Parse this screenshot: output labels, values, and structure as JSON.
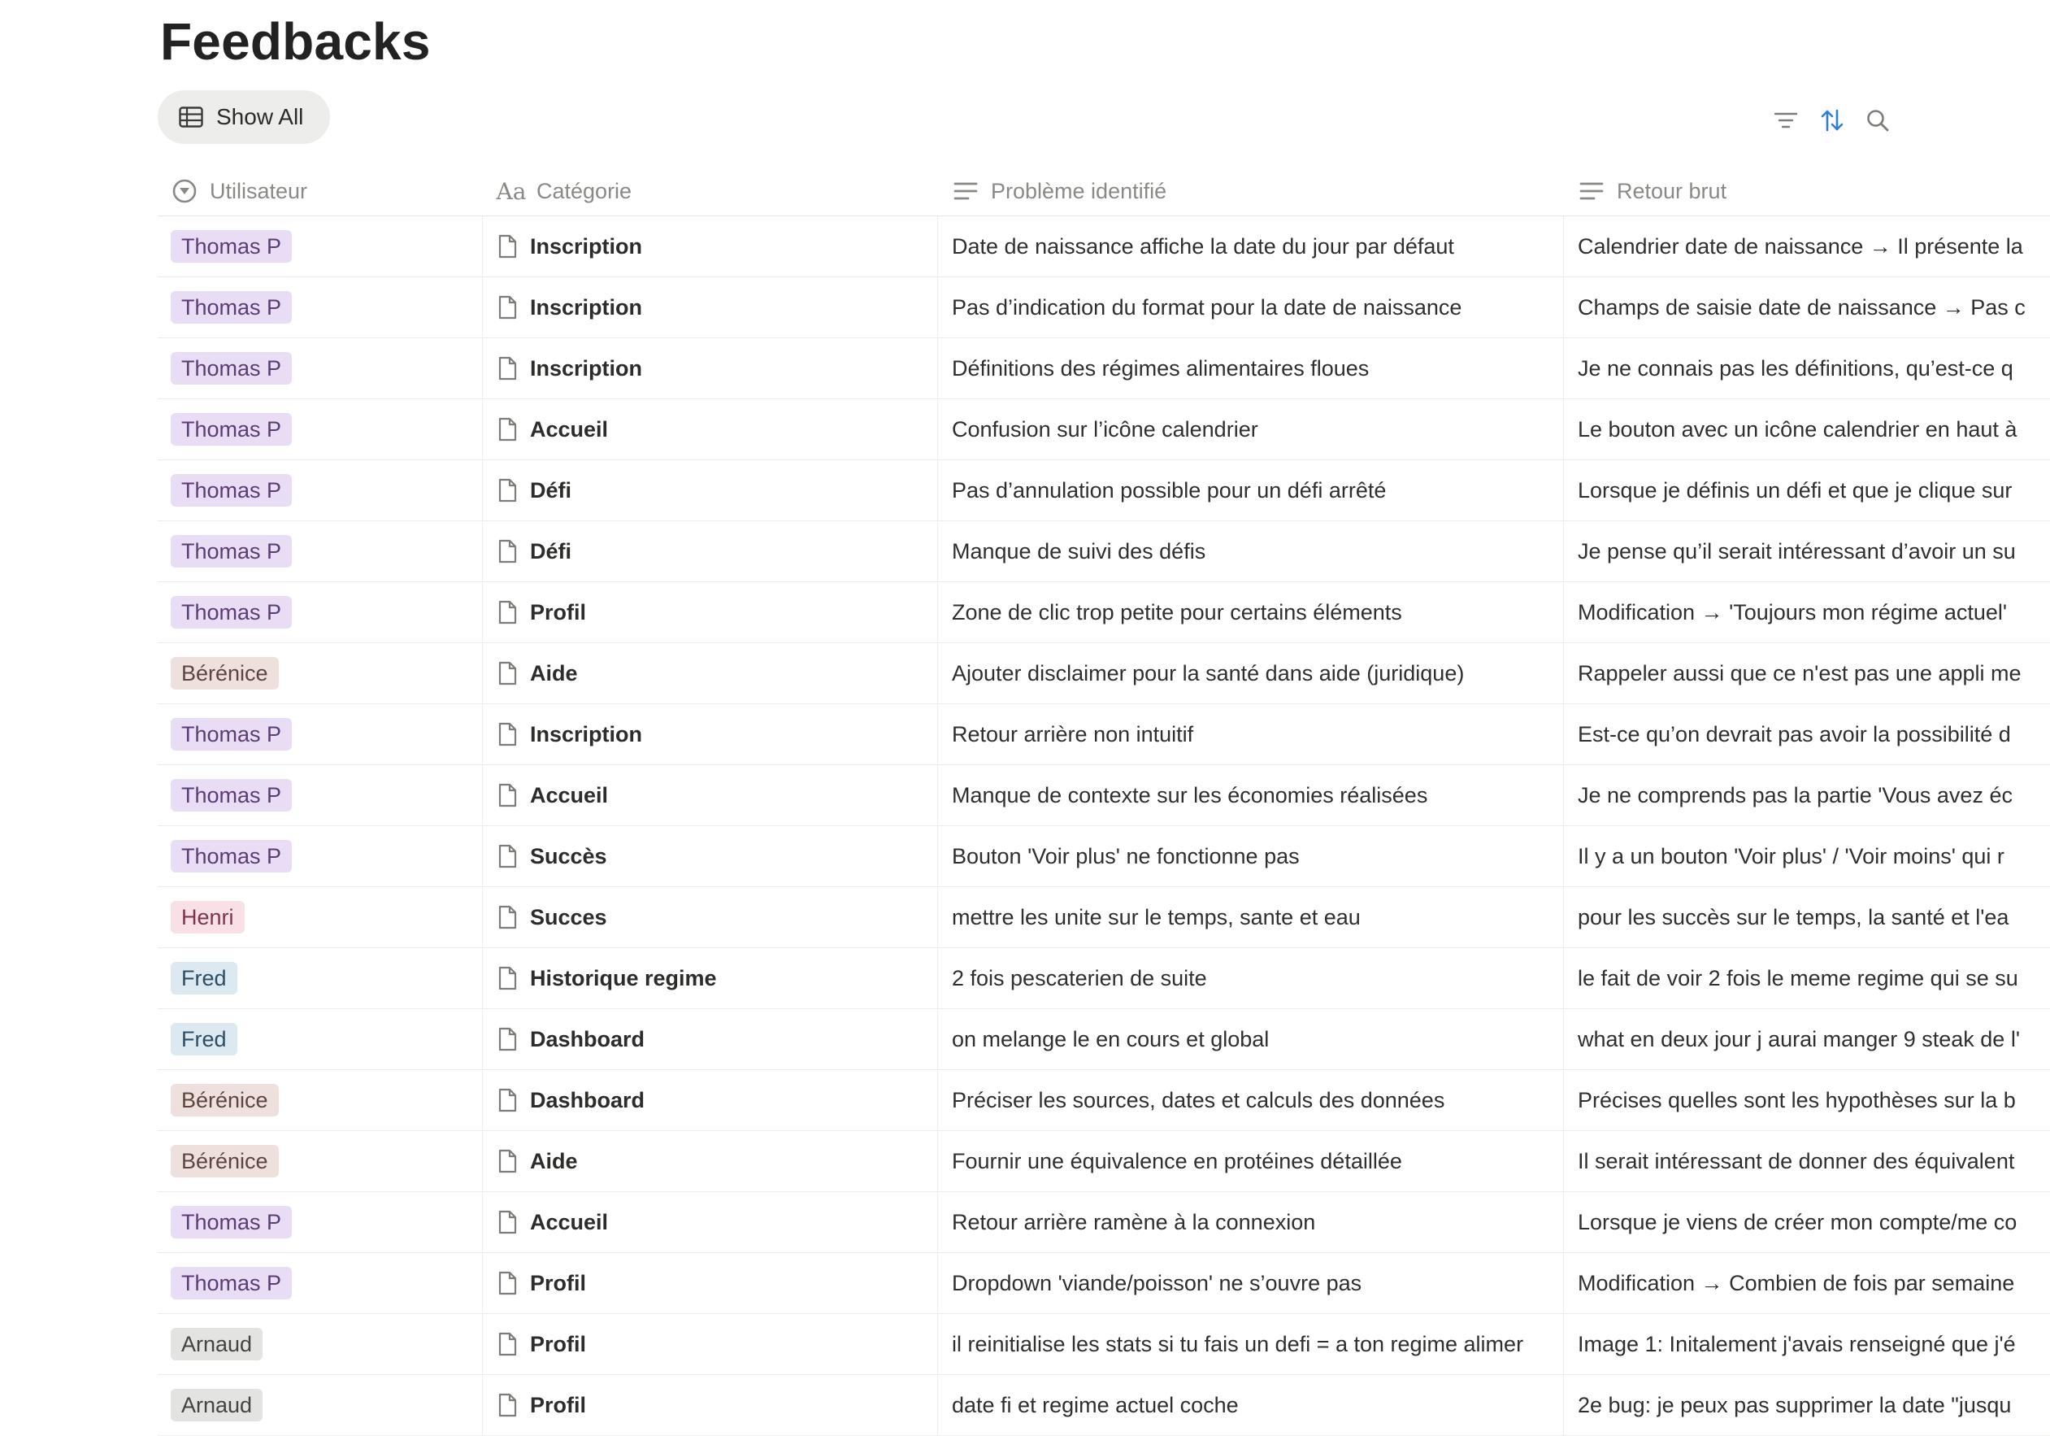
{
  "page": {
    "title": "Feedbacks"
  },
  "view": {
    "label": "Show All"
  },
  "columns": {
    "user": "Utilisateur",
    "category": "Catégorie",
    "problem": "Problème identifié",
    "raw": "Retour brut"
  },
  "colors": {
    "accent": "#2f7fd6",
    "tag_thomas_bg": "#e9ddf5",
    "tag_berenice_bg": "#eee0dd",
    "tag_henri_bg": "#f9dfe6",
    "tag_fred_bg": "#dde9f1",
    "tag_arnaud_bg": "#e3e3e1"
  },
  "rows": [
    {
      "user": "Thomas P",
      "tag": "thomas",
      "category": "Inscription",
      "problem": "Date de naissance affiche la date du jour par défaut",
      "raw": "Calendrier date de naissance → Il présente la"
    },
    {
      "user": "Thomas P",
      "tag": "thomas",
      "category": "Inscription",
      "problem": "Pas d’indication du format pour la date de naissance",
      "raw": "Champs de saisie date de naissance → Pas c"
    },
    {
      "user": "Thomas P",
      "tag": "thomas",
      "category": "Inscription",
      "problem": "Définitions des régimes alimentaires floues",
      "raw": "Je ne connais pas les définitions, qu’est-ce q"
    },
    {
      "user": "Thomas P",
      "tag": "thomas",
      "category": "Accueil",
      "problem": "Confusion sur l’icône calendrier",
      "raw": "Le bouton avec un icône calendrier en haut à"
    },
    {
      "user": "Thomas P",
      "tag": "thomas",
      "category": "Défi",
      "problem": "Pas d’annulation possible pour un défi arrêté",
      "raw": "Lorsque je définis un défi et que je clique sur"
    },
    {
      "user": "Thomas P",
      "tag": "thomas",
      "category": "Défi",
      "problem": "Manque de suivi des défis",
      "raw": "Je pense qu’il serait intéressant d’avoir un su"
    },
    {
      "user": "Thomas P",
      "tag": "thomas",
      "category": "Profil",
      "problem": "Zone de clic trop petite pour certains éléments",
      "raw": "Modification → 'Toujours mon régime actuel'"
    },
    {
      "user": "Bérénice",
      "tag": "berenice",
      "category": "Aide",
      "problem": "Ajouter disclaimer pour la santé dans aide (juridique)",
      "raw": "Rappeler aussi que ce n'est pas une appli me"
    },
    {
      "user": "Thomas P",
      "tag": "thomas",
      "category": "Inscription",
      "problem": "Retour arrière non intuitif",
      "raw": "Est-ce qu’on devrait pas avoir la possibilité d"
    },
    {
      "user": "Thomas P",
      "tag": "thomas",
      "category": "Accueil",
      "problem": "Manque de contexte sur les économies réalisées",
      "raw": "Je ne comprends pas la partie 'Vous avez éc"
    },
    {
      "user": "Thomas P",
      "tag": "thomas",
      "category": "Succès",
      "problem": "Bouton 'Voir plus' ne fonctionne pas",
      "raw": "Il y a un bouton 'Voir plus' / 'Voir moins' qui r"
    },
    {
      "user": "Henri",
      "tag": "henri",
      "category": "Succes",
      "problem": "mettre les unite sur le temps, sante et eau",
      "raw": "pour les succès sur le temps, la santé et l'ea"
    },
    {
      "user": "Fred",
      "tag": "fred",
      "category": "Historique regime",
      "problem": "2 fois pescaterien de suite",
      "raw": "le fait de voir 2 fois le meme regime qui se su"
    },
    {
      "user": "Fred",
      "tag": "fred",
      "category": "Dashboard",
      "problem": "on melange le en cours et global",
      "raw": "what en deux jour j aurai manger 9 steak de l'"
    },
    {
      "user": "Bérénice",
      "tag": "berenice",
      "category": "Dashboard",
      "problem": "Préciser les sources, dates et calculs des données",
      "raw": "Précises quelles sont les hypothèses sur la b"
    },
    {
      "user": "Bérénice",
      "tag": "berenice",
      "category": "Aide",
      "problem": "Fournir une équivalence en protéines détaillée",
      "raw": "Il serait intéressant de donner des équivalent"
    },
    {
      "user": "Thomas P",
      "tag": "thomas",
      "category": "Accueil",
      "problem": "Retour arrière ramène à la connexion",
      "raw": "Lorsque je viens de créer mon compte/me co"
    },
    {
      "user": "Thomas P",
      "tag": "thomas",
      "category": "Profil",
      "problem": "Dropdown 'viande/poisson' ne s’ouvre pas",
      "raw": "Modification → Combien de fois par semaine"
    },
    {
      "user": "Arnaud",
      "tag": "arnaud",
      "category": "Profil",
      "problem": "il reinitialise les stats si tu fais un defi = a ton regime alimer",
      "raw": "Image 1: Initalement j'avais renseigné que j'é"
    },
    {
      "user": "Arnaud",
      "tag": "arnaud",
      "category": "Profil",
      "problem": "date fi et regime actuel coche",
      "raw": "2e bug: je peux pas supprimer la date \"jusqu"
    }
  ]
}
